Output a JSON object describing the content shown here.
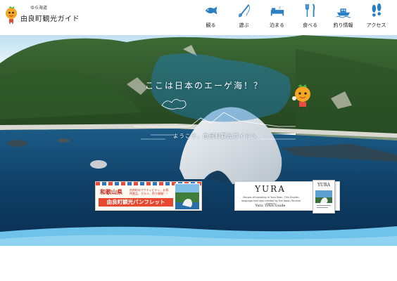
{
  "header": {
    "logo_sub": "ゆら海道",
    "logo_title": "由良町観光ガイド"
  },
  "nav": [
    {
      "label": "観る",
      "icon": "fish-icon"
    },
    {
      "label": "遊ぶ",
      "icon": "fishing-rod-icon"
    },
    {
      "label": "泊まる",
      "icon": "bed-icon"
    },
    {
      "label": "食べる",
      "icon": "fork-knife-icon"
    },
    {
      "label": "釣り情報",
      "icon": "boat-icon"
    },
    {
      "label": "アクセス",
      "icon": "footprints-icon"
    }
  ],
  "hero": {
    "headline": "ここは日本のエーゲ海！？",
    "welcome": "ようこそ、由良町観光ガイドへ"
  },
  "banner_pamphlet": {
    "prefecture": "和歌山県",
    "description": "由良町のアクティビティ、お祭、特産品、グルメ、釣り情報！！",
    "title": "由良町観光パンフレット"
  },
  "banner_guide": {
    "title": "YURA",
    "description": "Record of traveling in Yura Town. This English language text was created by the Japan Tourism Agency.",
    "subtitle": "Yura Town Guide",
    "cover_title": "YURA"
  },
  "colors": {
    "sea": "#0f3f66",
    "accent_blue": "#2a7fc4",
    "pamphlet_red": "#e8482f"
  }
}
